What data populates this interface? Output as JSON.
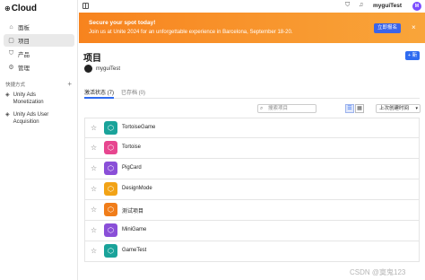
{
  "logo": {
    "mark": "⊕",
    "text": "Cloud"
  },
  "sidebar": {
    "items": [
      {
        "icon": "home-icon",
        "glyph": "⌂",
        "label": "面板"
      },
      {
        "icon": "folder-icon",
        "glyph": "▢",
        "label": "项目"
      },
      {
        "icon": "bag-icon",
        "glyph": "⛉",
        "label": "产品"
      },
      {
        "icon": "gear-icon",
        "glyph": "⚙",
        "label": "管理"
      }
    ],
    "shortcuts_title": "快捷方式",
    "shortcuts": [
      {
        "glyph": "◈",
        "line1": "Unity Ads",
        "line2": "Monetization"
      },
      {
        "glyph": "◈",
        "line1": "Unity Ads User",
        "line2": "Acquisition"
      }
    ]
  },
  "topbar": {
    "user": "myguiTest",
    "avatar": "M"
  },
  "banner": {
    "title": "Secure your spot today!",
    "subtitle": "Join us at Unite 2024 for an unforgettable experience in Barcelona, September 18-20.",
    "button": "立即报名",
    "close": "×"
  },
  "main": {
    "title": "项目",
    "new_button": "+ 新",
    "org_initial": " ",
    "org_name": "myguiTest",
    "tabs": [
      {
        "label": "激活状态 (7)"
      },
      {
        "label": "已存档 (0)"
      }
    ],
    "search_placeholder": "搜索项目",
    "sort_label": "上次创建时间"
  },
  "projects": [
    {
      "name": "TortoiseGame",
      "color": "#1aa39a"
    },
    {
      "name": "Tortoise",
      "color": "#e7468f"
    },
    {
      "name": "PigCard",
      "color": "#8a4fd8"
    },
    {
      "name": "DesignMode",
      "color": "#f2a316"
    },
    {
      "name": "测试项目",
      "color": "#f07d1a"
    },
    {
      "name": "MiniGame",
      "color": "#8a4fd8"
    },
    {
      "name": "GameTest",
      "color": "#1aa39a"
    }
  ],
  "watermark": "CSDN @寞鬼123"
}
